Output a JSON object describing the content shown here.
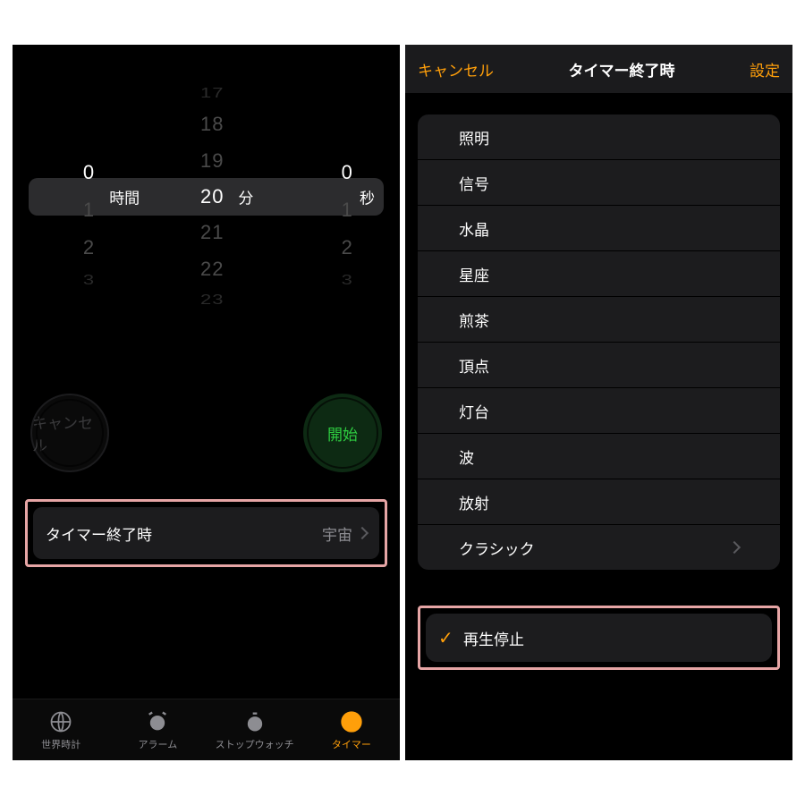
{
  "left": {
    "picker": {
      "hours": {
        "rows": [
          "",
          "",
          "0",
          "1",
          "2",
          "3"
        ],
        "selected_index": 2,
        "unit": "時間"
      },
      "minutes": {
        "rows": [
          "17",
          "18",
          "19",
          "20",
          "21",
          "22",
          "23"
        ],
        "selected_index": 3,
        "unit": "分"
      },
      "seconds": {
        "rows": [
          "",
          "",
          "0",
          "1",
          "2",
          "3"
        ],
        "selected_index": 2,
        "unit": "秒"
      }
    },
    "cancel": "キャンセル",
    "start": "開始",
    "end_label": "タイマー終了時",
    "end_value": "宇宙",
    "tabs": [
      {
        "label": "世界時計"
      },
      {
        "label": "アラーム"
      },
      {
        "label": "ストップウォッチ"
      },
      {
        "label": "タイマー"
      }
    ]
  },
  "right": {
    "cancel": "キャンセル",
    "title": "タイマー終了時",
    "set": "設定",
    "sounds": [
      "照明",
      "信号",
      "水晶",
      "星座",
      "煎茶",
      "頂点",
      "灯台",
      "波",
      "放射",
      "クラシック"
    ],
    "stop": "再生停止"
  }
}
